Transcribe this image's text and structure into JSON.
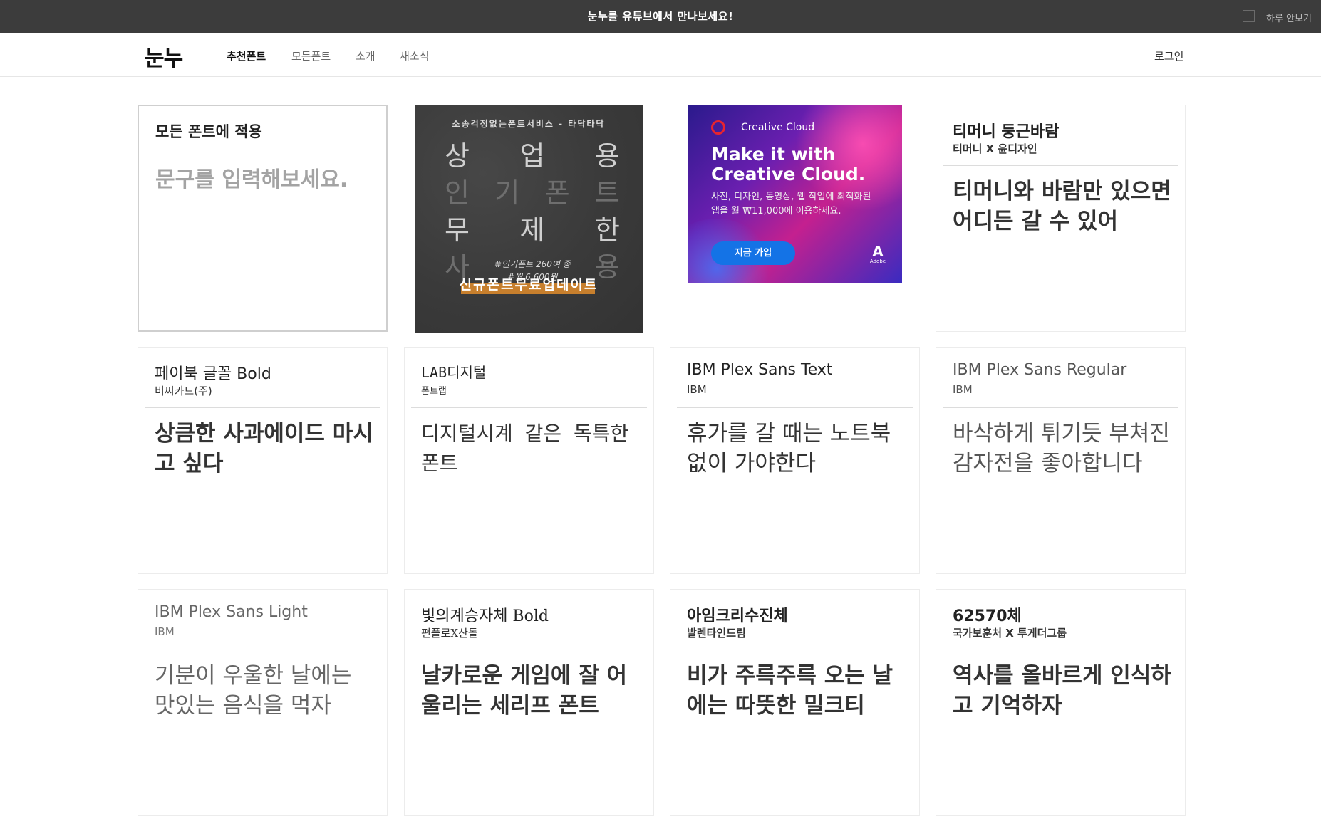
{
  "banner": {
    "message": "눈누를 유튜브에서 만나보세요!",
    "hide_today": "하루 안보기"
  },
  "nav": {
    "logo": "눈누",
    "links": [
      "추천폰트",
      "모든폰트",
      "소개",
      "새소식"
    ],
    "login": "로그인"
  },
  "apply": {
    "title": "모든 폰트에 적용",
    "placeholder": "문구를 입력해보세요."
  },
  "ad1": {
    "tagline": "소송걱정없는폰트서비스 - 타닥타닥",
    "rows": [
      [
        "상",
        "업",
        "용"
      ],
      [
        "인",
        "기",
        "폰",
        "트"
      ],
      [
        "무",
        "제",
        "한"
      ],
      [
        "사",
        "용"
      ]
    ],
    "note_line1": "#인기폰트 260여 종",
    "note_line2": "#월 6,600원",
    "bottom": "신규폰트무료업데이트"
  },
  "ad2": {
    "brand": "Creative Cloud",
    "headline_line1": "Make it with",
    "headline_line2": "Creative Cloud.",
    "body": "사진, 디자인, 동영상, 웹 작업에 최적화된 앱을 월 ₩11,000에 이용하세요.",
    "button": "지금 가입",
    "logo_text": "Adobe"
  },
  "fonts": [
    {
      "name": "티머니 둥근바람",
      "maker": "티머니 X 윤디자인",
      "sample": "티머니와 바람만 있으면 어디든 갈 수 있어"
    },
    {
      "name": "페이북 글꼴 Bold",
      "maker": "비씨카드(주)",
      "sample": "상큼한 사과에이드 마시고 싶다"
    },
    {
      "name": "LAB디지털",
      "maker": "폰트랩",
      "sample": "디지털시계 같은 독특한 폰트"
    },
    {
      "name": "IBM Plex Sans Text",
      "maker": "IBM",
      "sample": "휴가를 갈 때는 노트북 없이 가야한다"
    },
    {
      "name": "IBM Plex Sans Regular",
      "maker": "IBM",
      "sample": "바삭하게 튀기듯 부쳐진 감자전을 좋아합니다"
    },
    {
      "name": "IBM Plex Sans Light",
      "maker": "IBM",
      "sample": "기분이 우울한 날에는 맛있는 음식을 먹자"
    },
    {
      "name": "빛의계승자체 Bold",
      "maker": "펀플로X산돌",
      "sample": "날카로운 게임에 잘 어울리는 세리프 폰트"
    },
    {
      "name": "아임크리수진체",
      "maker": "발렌타인드림",
      "sample": "비가 주륵주륵 오는 날에는 따뜻한 밀크티"
    },
    {
      "name": "62570체",
      "maker": "국가보훈처 X 투게더그룹",
      "sample": "역사를 올바르게 인식하고 기억하자"
    }
  ]
}
